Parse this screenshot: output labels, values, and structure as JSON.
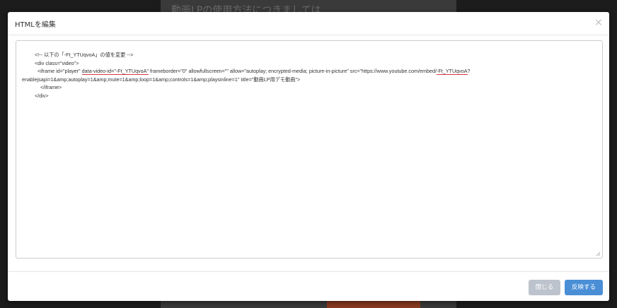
{
  "background": {
    "page_title": "動画LPの使用方法につきましては"
  },
  "modal": {
    "title": "HTMLを編集",
    "close_icon": "close-icon",
    "close_glyph": "×",
    "code": {
      "line1": "<!-- 以下の「-Ft_YTUqvoA」の値を変更 -->",
      "line2": "<div class=\"video\">",
      "line3_a": "<iframe id=\"player\" ",
      "line3_b": "data-video-id=\"-Ft_YTUqvoA\"",
      "line3_c": " frameborder=\"0\" allowfullscreen=\"\" allow=\"autoplay; encrypted-media; picture-in-picture\" src=\"https://www.youtube.com/embed/",
      "line3_d": "-Ft_YTUqvoA",
      "line3_e": "?",
      "line4": "enablejsapi=1&amp;autoplay=1&amp;mute=1&amp;loop=1&amp;controls=1&amp;playsinline=1\" title=\"動画LP用デモ動画\">",
      "line5": "</iframe>",
      "line6": "</div>"
    },
    "footer": {
      "close_label": "閉じる",
      "apply_label": "反映する"
    },
    "colors": {
      "underline": "#d9363e",
      "apply_button": "#4a8fd6",
      "close_button": "#bcc3cc"
    }
  }
}
